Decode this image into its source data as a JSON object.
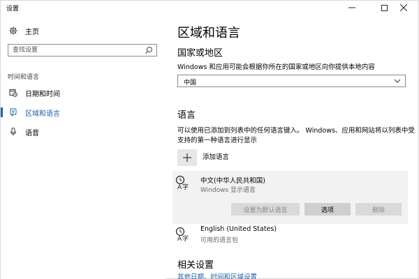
{
  "window": {
    "title": "设置",
    "minimize_icon": "minimize-icon",
    "maximize_icon": "maximize-icon",
    "close_icon": "close-icon"
  },
  "sidebar": {
    "home_label": "主页",
    "home_icon": "gear-icon",
    "search_placeholder": "查找设置",
    "search_icon": "search-icon",
    "section_title": "时间和语言",
    "items": [
      {
        "label": "日期和时间",
        "icon": "calendar-clock-icon",
        "active": false
      },
      {
        "label": "区域和语言",
        "icon": "region-icon",
        "active": true
      },
      {
        "label": "语音",
        "icon": "microphone-icon",
        "active": false
      }
    ]
  },
  "main": {
    "page_title": "区域和语言",
    "country_section": {
      "heading": "国家或地区",
      "description": "Windows 和应用可能会根据你所在的国家或地区向你提供本地内容",
      "selected_value": "中国"
    },
    "language_section": {
      "heading": "语言",
      "description": "可以使用已添加到列表中的任何语言键入。 Windows、应用和网站将以列表中受支持的第一种语言进行显示",
      "add_label": "添加语言",
      "languages": [
        {
          "name": "中文(中华人民共和国)",
          "sub": "Windows 显示语言",
          "icon": "language-icon",
          "selected": true
        },
        {
          "name": "English (United States)",
          "sub": "可用的语言包",
          "icon": "language-icon",
          "selected": false
        }
      ],
      "buttons": {
        "set_default": "设置为默认语言",
        "options": "选项",
        "remove": "删除"
      }
    },
    "related_section": {
      "heading": "相关设置",
      "link": "其他日期、时间和区域设置"
    }
  },
  "colors": {
    "accent": "#1f5fa8",
    "panel": "#f2f2f2",
    "button": "#d6d6d6"
  }
}
